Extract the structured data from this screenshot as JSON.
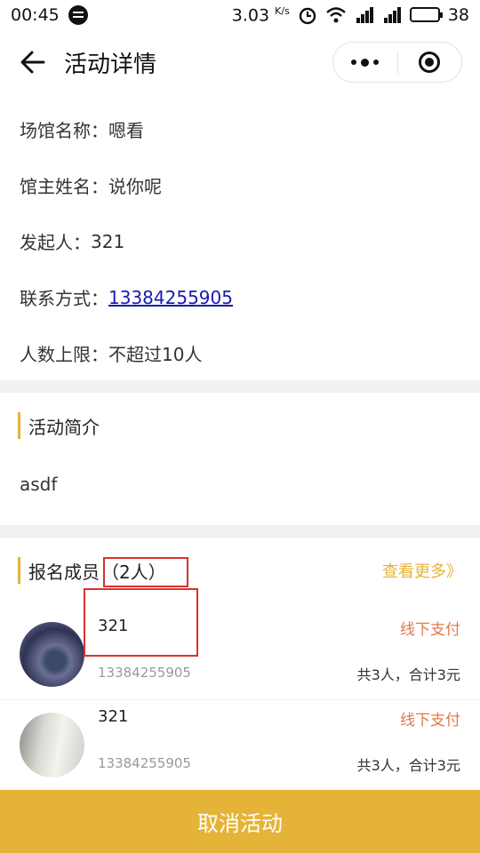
{
  "status_bar": {
    "time": "00:45",
    "speed": "3.03",
    "speed_unit": "K/s",
    "battery": "38"
  },
  "nav": {
    "title": "活动详情"
  },
  "info": [
    {
      "label": "场馆名称：",
      "value": "嗯看"
    },
    {
      "label": "馆主姓名：",
      "value": "说你呢"
    },
    {
      "label": "发起人：",
      "value": "321"
    },
    {
      "label": "联系方式：",
      "value": "13384255905"
    },
    {
      "label": "人数上限：",
      "value": "不超过10人"
    }
  ],
  "intro": {
    "title": "活动简介",
    "text": "asdf"
  },
  "members": {
    "title": "报名成员",
    "count": "（2人）",
    "more": "查看更多》",
    "list": [
      {
        "name": "321",
        "phone": "13384255905",
        "payment": "线下支付",
        "total": "共3人，合计3元"
      },
      {
        "name": "321",
        "phone": "13384255905",
        "payment": "线下支付",
        "total": "共3人，合计3元"
      }
    ]
  },
  "actions": {
    "cancel": "取消活动"
  },
  "colors": {
    "accent": "#e4b338",
    "payment": "#e07a4a",
    "link": "#1a1ab3",
    "highlight_box": "#d9312b"
  }
}
